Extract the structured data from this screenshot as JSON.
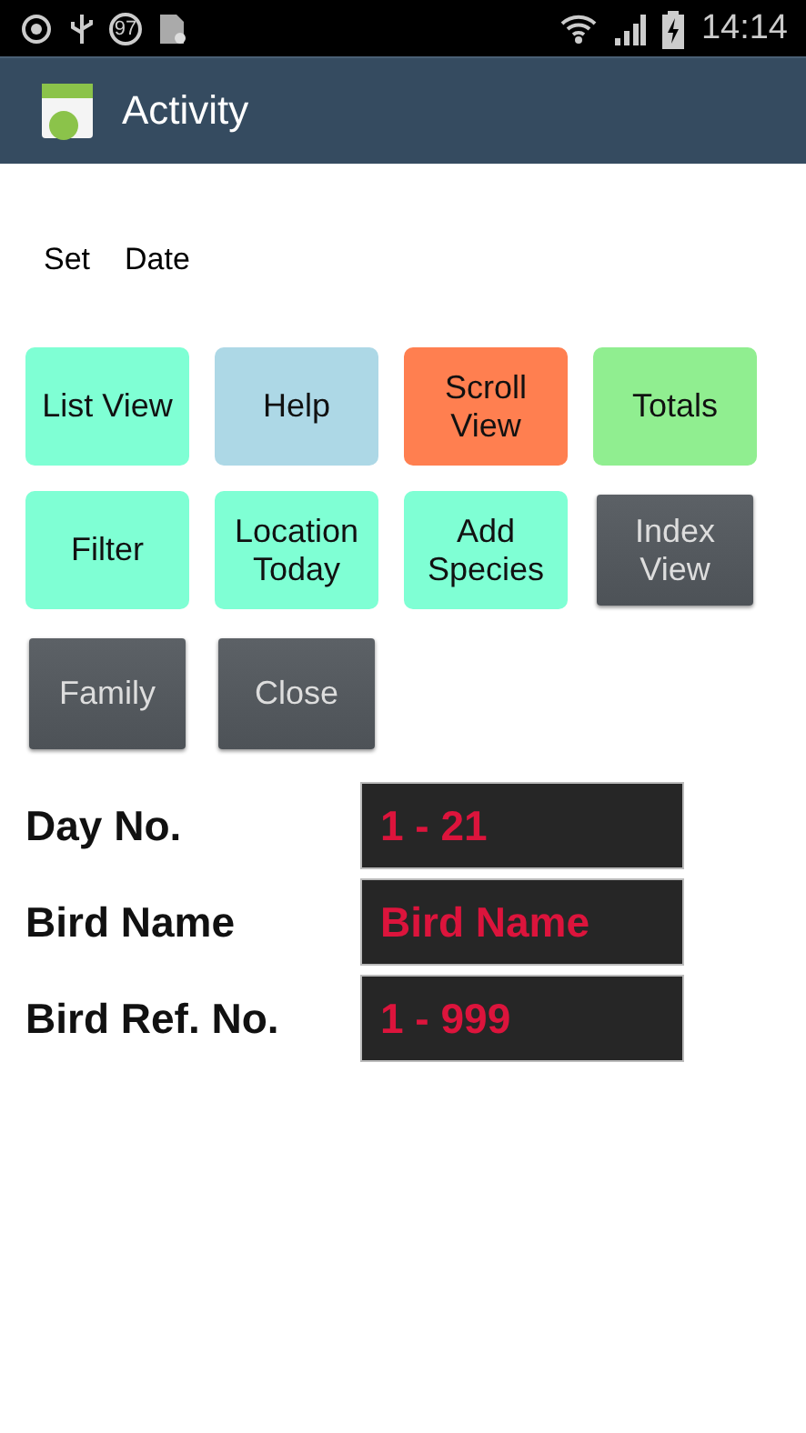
{
  "status_bar": {
    "badge": "97",
    "time": "14:14"
  },
  "action_bar": {
    "title": "Activity"
  },
  "date_labels": [
    "Set",
    "Date"
  ],
  "buttons": [
    {
      "label": "List View",
      "kind": "flat",
      "color": "#7fffd4"
    },
    {
      "label": "Help",
      "kind": "flat",
      "color": "#add8e6"
    },
    {
      "label": "Scroll View",
      "kind": "flat",
      "color": "#ff7f50"
    },
    {
      "label": "Totals",
      "kind": "flat",
      "color": "#90ee90"
    },
    {
      "label": "Filter",
      "kind": "flat",
      "color": "#7fffd4"
    },
    {
      "label": "Location Today",
      "kind": "flat",
      "color": "#7fffd4"
    },
    {
      "label": "Add Species",
      "kind": "flat",
      "color": "#7fffd4"
    },
    {
      "label": "Index View",
      "kind": "dark"
    },
    {
      "label": "Family",
      "kind": "dark"
    },
    {
      "label": "Close",
      "kind": "dark"
    }
  ],
  "fields": [
    {
      "label": "Day No.",
      "placeholder": "1 - 21"
    },
    {
      "label": "Bird Name",
      "placeholder": "Bird Name"
    },
    {
      "label": "Bird Ref. No.",
      "placeholder": "1 - 999"
    }
  ]
}
